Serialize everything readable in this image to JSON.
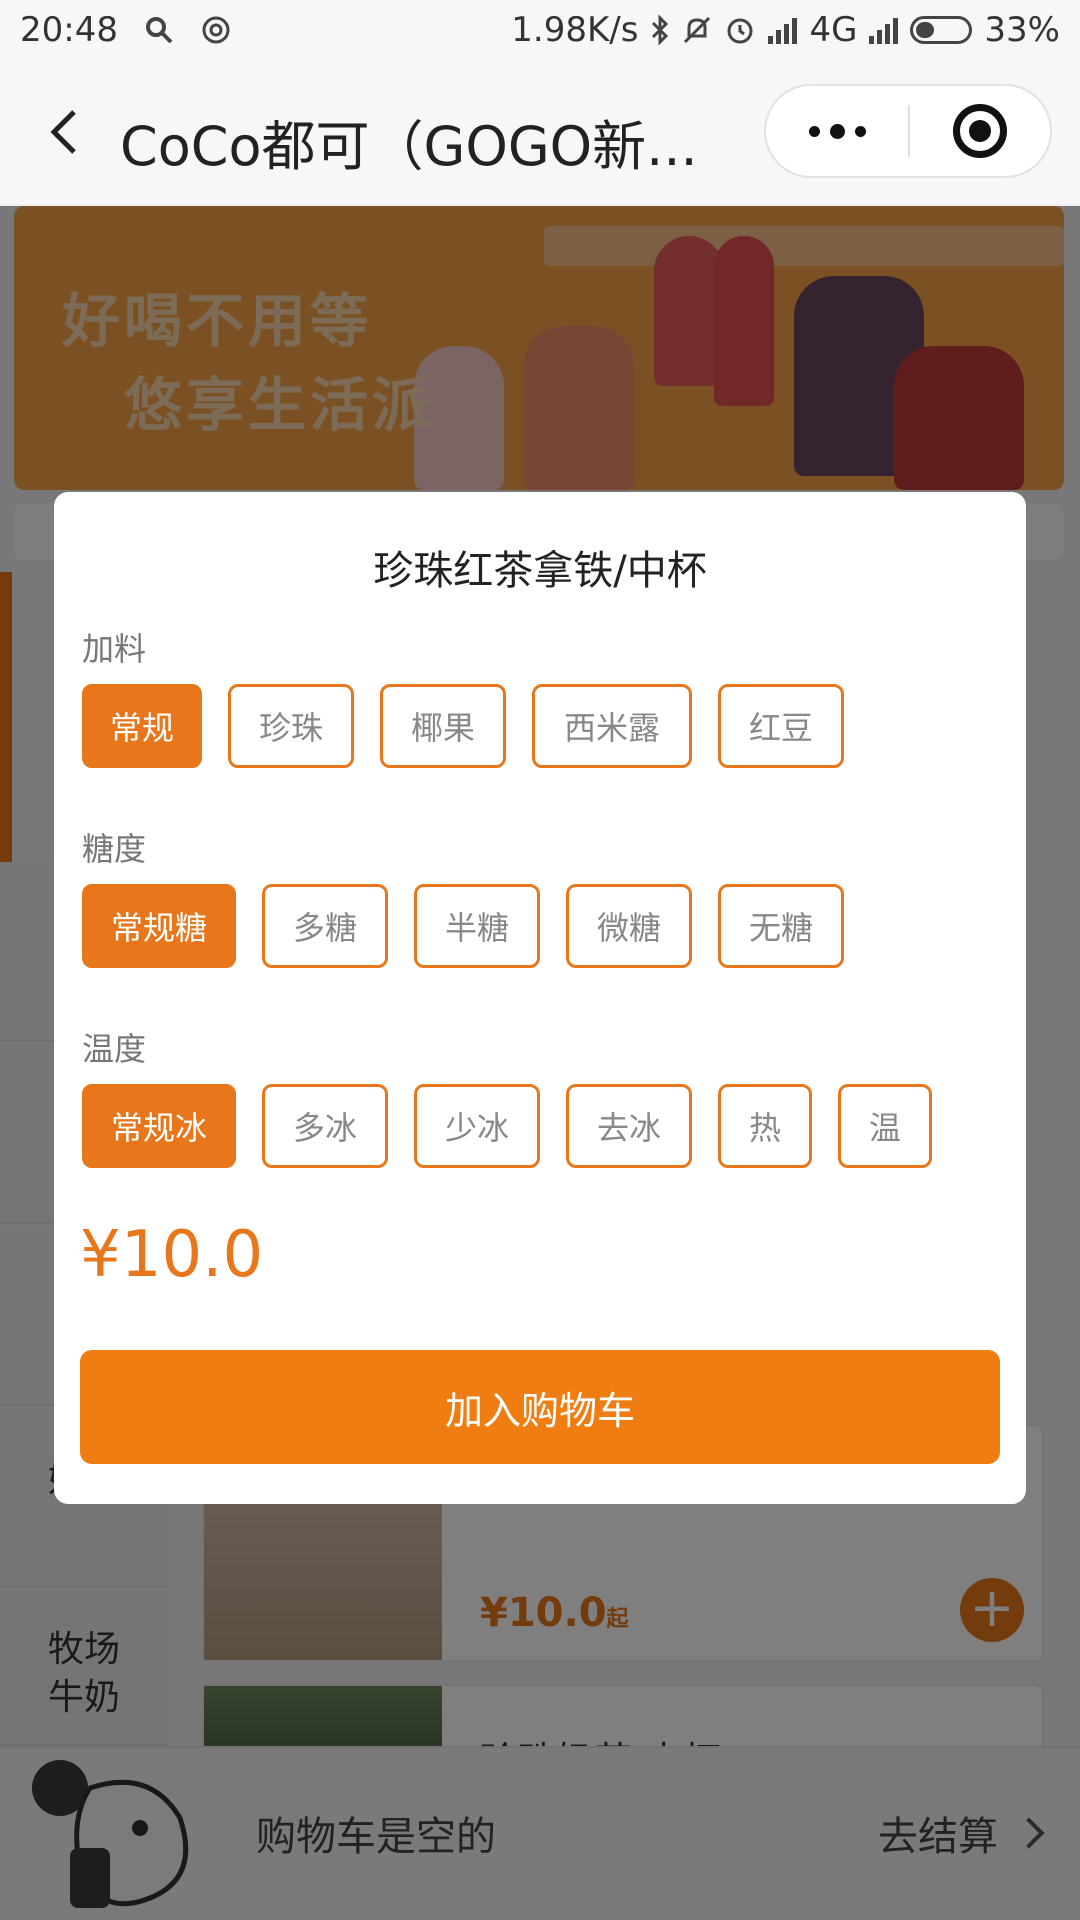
{
  "status_bar": {
    "time": "20:48",
    "network_speed": "1.98K/s",
    "network_type": "4G",
    "battery": "33%"
  },
  "nav": {
    "title": "CoCo都可（GOGO新..."
  },
  "banner": {
    "line1": "好喝不用等",
    "line2": "悠享生活派"
  },
  "categories": [
    {
      "line1": "",
      "line2": ""
    },
    {
      "line1": "",
      "line2": ""
    },
    {
      "line1": "",
      "line2": ""
    },
    {
      "line1": "",
      "line2": "奶茶"
    },
    {
      "line1": "牧场",
      "line2": "牛奶"
    }
  ],
  "product_card": {
    "price": "¥10.0",
    "price_suffix": "起",
    "next_title": "珍珠奶茶/中杯"
  },
  "cart": {
    "empty_text": "购物车是空的",
    "checkout_label": "去结算"
  },
  "modal": {
    "title": "珍珠红茶拿铁/中杯",
    "sections": [
      {
        "label": "加料",
        "options": [
          "常规",
          "珍珠",
          "椰果",
          "西米露",
          "红豆"
        ],
        "selected": 0
      },
      {
        "label": "糖度",
        "options": [
          "常规糖",
          "多糖",
          "半糖",
          "微糖",
          "无糖"
        ],
        "selected": 0
      },
      {
        "label": "温度",
        "options": [
          "常规冰",
          "多冰",
          "少冰",
          "去冰",
          "热",
          "温"
        ],
        "selected": 0
      }
    ],
    "price": "¥10.0",
    "add_button": "加入购物车"
  },
  "colors": {
    "accent": "#e8761a",
    "button": "#ef7d12"
  }
}
